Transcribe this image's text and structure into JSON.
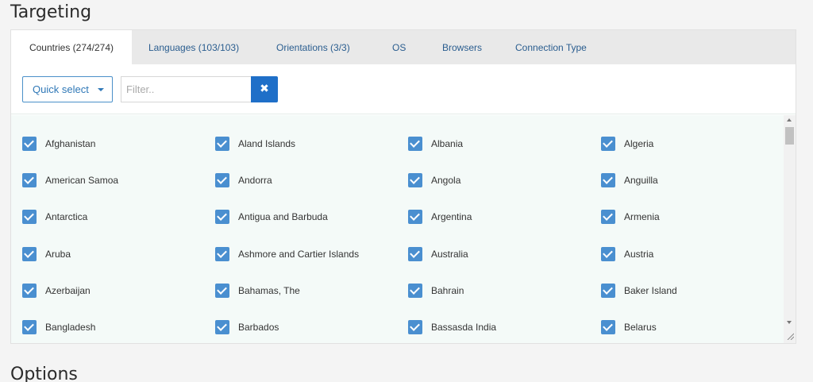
{
  "headings": {
    "targeting": "Targeting",
    "options": "Options"
  },
  "tabs": [
    {
      "label": "Countries (274/274)",
      "active": true
    },
    {
      "label": "Languages (103/103)",
      "active": false
    },
    {
      "label": "Orientations (3/3)",
      "active": false
    },
    {
      "label": "OS",
      "active": false
    },
    {
      "label": "Browsers",
      "active": false
    },
    {
      "label": "Connection Type",
      "active": false
    }
  ],
  "toolbar": {
    "quick_select_label": "Quick select",
    "filter_placeholder": "Filter..",
    "filter_value": "",
    "clear_symbol": "✖"
  },
  "countries": [
    {
      "name": "Afghanistan",
      "checked": true
    },
    {
      "name": "Aland Islands",
      "checked": true
    },
    {
      "name": "Albania",
      "checked": true
    },
    {
      "name": "Algeria",
      "checked": true
    },
    {
      "name": "American Samoa",
      "checked": true
    },
    {
      "name": "Andorra",
      "checked": true
    },
    {
      "name": "Angola",
      "checked": true
    },
    {
      "name": "Anguilla",
      "checked": true
    },
    {
      "name": "Antarctica",
      "checked": true
    },
    {
      "name": "Antigua and Barbuda",
      "checked": true
    },
    {
      "name": "Argentina",
      "checked": true
    },
    {
      "name": "Armenia",
      "checked": true
    },
    {
      "name": "Aruba",
      "checked": true
    },
    {
      "name": "Ashmore and Cartier Islands",
      "checked": true
    },
    {
      "name": "Australia",
      "checked": true
    },
    {
      "name": "Austria",
      "checked": true
    },
    {
      "name": "Azerbaijan",
      "checked": true
    },
    {
      "name": "Bahamas, The",
      "checked": true
    },
    {
      "name": "Bahrain",
      "checked": true
    },
    {
      "name": "Baker Island",
      "checked": true
    },
    {
      "name": "Bangladesh",
      "checked": true
    },
    {
      "name": "Barbados",
      "checked": true
    },
    {
      "name": "Bassasda India",
      "checked": true
    },
    {
      "name": "Belarus",
      "checked": true
    }
  ],
  "colors": {
    "accent": "#1f6fc8",
    "checkbox": "#4a8fd0",
    "tab_link": "#2a5d8f",
    "list_bg": "#f4faf8"
  }
}
